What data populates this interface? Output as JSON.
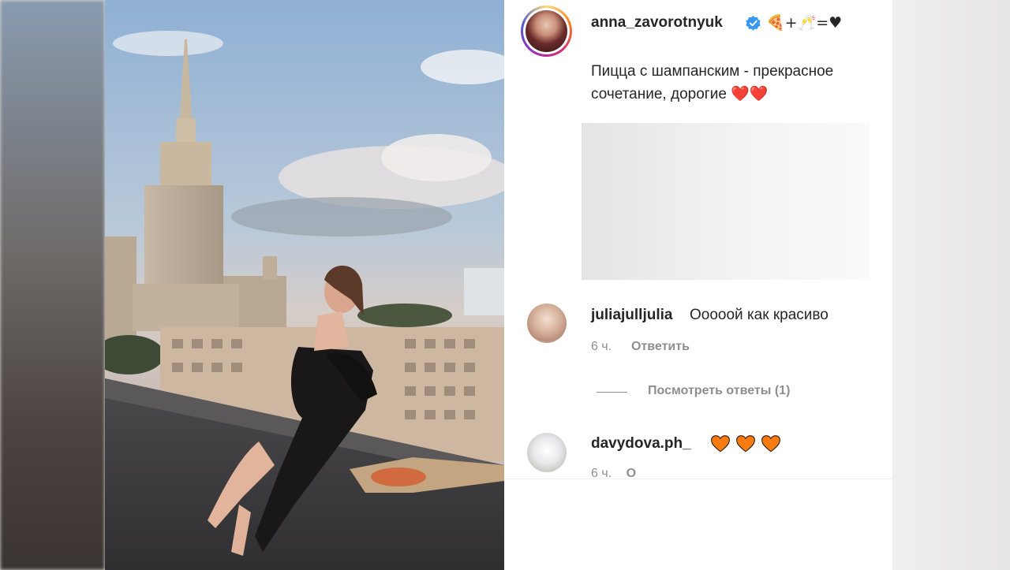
{
  "post": {
    "author": "anna_zavorotnyuk",
    "title_emojis": "🍕+🥂=♥",
    "caption": "Пицца с шампанским - прекрасное сочетание, дорогие ❤️❤️"
  },
  "comments": [
    {
      "username": "juliajulljulia",
      "text": "Ооооой как красиво",
      "time": "6 ч.",
      "reply_label": "Ответить",
      "view_replies": "Посмотреть ответы (1)"
    },
    {
      "username": "davydova.ph_",
      "text": "🧡🧡🧡",
      "time": "6 ч.",
      "reply_label": "О"
    }
  ],
  "colors": {
    "heart": "#f77b10",
    "verified": "#3897f0",
    "text": "#262626",
    "muted": "#8e8e8e"
  },
  "icons": {
    "verified": "verified-badge-icon",
    "heart": "orange-heart-emoji"
  }
}
